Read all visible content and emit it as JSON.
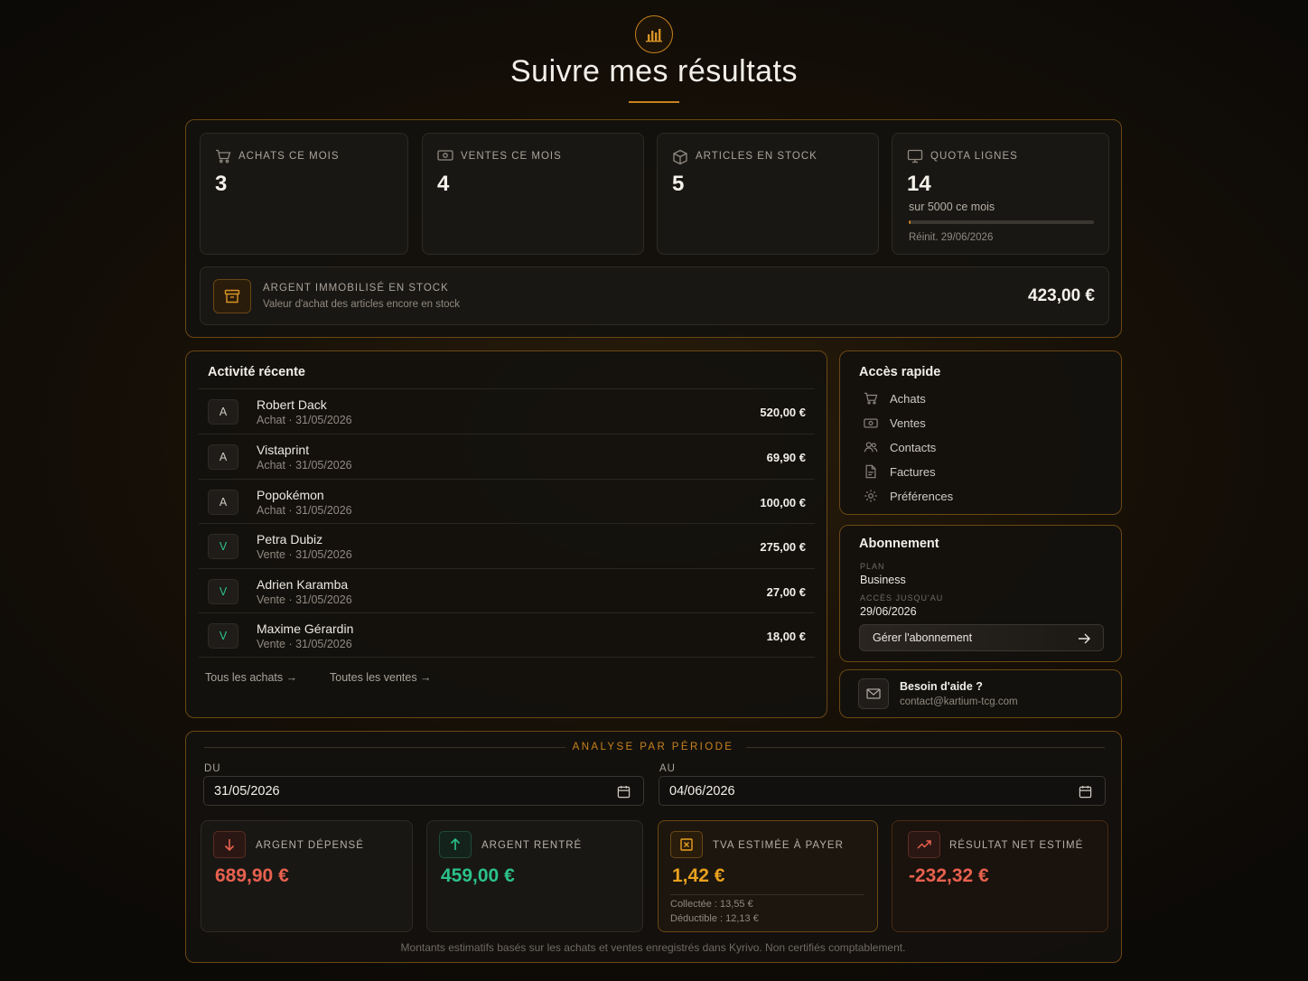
{
  "header": {
    "title": "Suivre mes résultats",
    "logo_icon": "bar-chart-icon"
  },
  "stats": [
    {
      "label": "ACHATS CE MOIS",
      "value": "3",
      "icon": "cart-icon"
    },
    {
      "label": "VENTES CE MOIS",
      "value": "4",
      "icon": "cash-icon"
    },
    {
      "label": "ARTICLES EN STOCK",
      "value": "5",
      "icon": "box-icon"
    },
    {
      "label": "QUOTA LIGNES",
      "value": "14",
      "icon": "monitor-icon",
      "sub": "sur 5000 ce mois",
      "reset": "Réinit. 29/06/2026",
      "progress": 0.0028
    }
  ],
  "stock_value": {
    "title": "ARGENT IMMOBILISÉ EN STOCK",
    "description": "Valeur d'achat des articles encore en stock",
    "amount": "423,00 €",
    "icon": "archive-icon"
  },
  "activity": {
    "title": "Activité récente",
    "rows": [
      {
        "badge": "A",
        "name": "Robert Dack",
        "meta": "Achat · 31/05/2026",
        "amount": "520,00 €"
      },
      {
        "badge": "A",
        "name": "Vistaprint",
        "meta": "Achat · 31/05/2026",
        "amount": "69,90 €"
      },
      {
        "badge": "A",
        "name": "Popokémon",
        "meta": "Achat · 31/05/2026",
        "amount": "100,00 €"
      },
      {
        "badge": "V",
        "name": "Petra Dubiz",
        "meta": "Vente · 31/05/2026",
        "amount": "275,00 €"
      },
      {
        "badge": "V",
        "name": "Adrien Karamba",
        "meta": "Vente · 31/05/2026",
        "amount": "27,00 €"
      },
      {
        "badge": "V",
        "name": "Maxime Gérardin",
        "meta": "Vente · 31/05/2026",
        "amount": "18,00 €"
      }
    ],
    "link_purchases": "Tous les achats →",
    "link_sales": "Toutes les ventes →"
  },
  "quick_access": {
    "title": "Accès rapide",
    "items": [
      {
        "label": "Achats",
        "icon": "cart-icon"
      },
      {
        "label": "Ventes",
        "icon": "cash-icon"
      },
      {
        "label": "Contacts",
        "icon": "users-icon"
      },
      {
        "label": "Factures",
        "icon": "document-icon"
      },
      {
        "label": "Préférences",
        "icon": "gear-icon"
      }
    ]
  },
  "subscription": {
    "title": "Abonnement",
    "plan_label": "PLAN",
    "plan": "Business",
    "access_label": "ACCÈS JUSQU'AU",
    "access_until": "29/06/2026",
    "manage_label": "Gérer l'abonnement"
  },
  "help": {
    "title": "Besoin d'aide ?",
    "email": "contact@kartium-tcg.com",
    "icon": "mail-icon"
  },
  "period": {
    "title": "ANALYSE PAR PÉRIODE",
    "from_label": "DU",
    "from_value": "31/05/2026",
    "to_label": "AU",
    "to_value": "04/06/2026",
    "cards": [
      {
        "label": "ARGENT DÉPENSÉ",
        "value": "689,90 €",
        "color": "#e8614f",
        "icon": "arrow-down-icon"
      },
      {
        "label": "ARGENT RENTRÉ",
        "value": "459,00 €",
        "color": "#2bc28a",
        "icon": "arrow-up-icon"
      },
      {
        "label": "TVA ESTIMÉE À PAYER",
        "value": "1,42 €",
        "color": "#e8a01e",
        "icon": "tax-icon",
        "collected": "Collectée : 13,55 €",
        "deductible": "Déductible : 12,13 €"
      },
      {
        "label": "RÉSULTAT NET ESTIMÉ",
        "value": "-232,32 €",
        "color": "#e8614f",
        "icon": "trend-up-icon"
      }
    ],
    "footnote": "Montants estimatifs basés sur les achats et ventes enregistrés dans Kyrivo. Non certifiés comptablement."
  }
}
